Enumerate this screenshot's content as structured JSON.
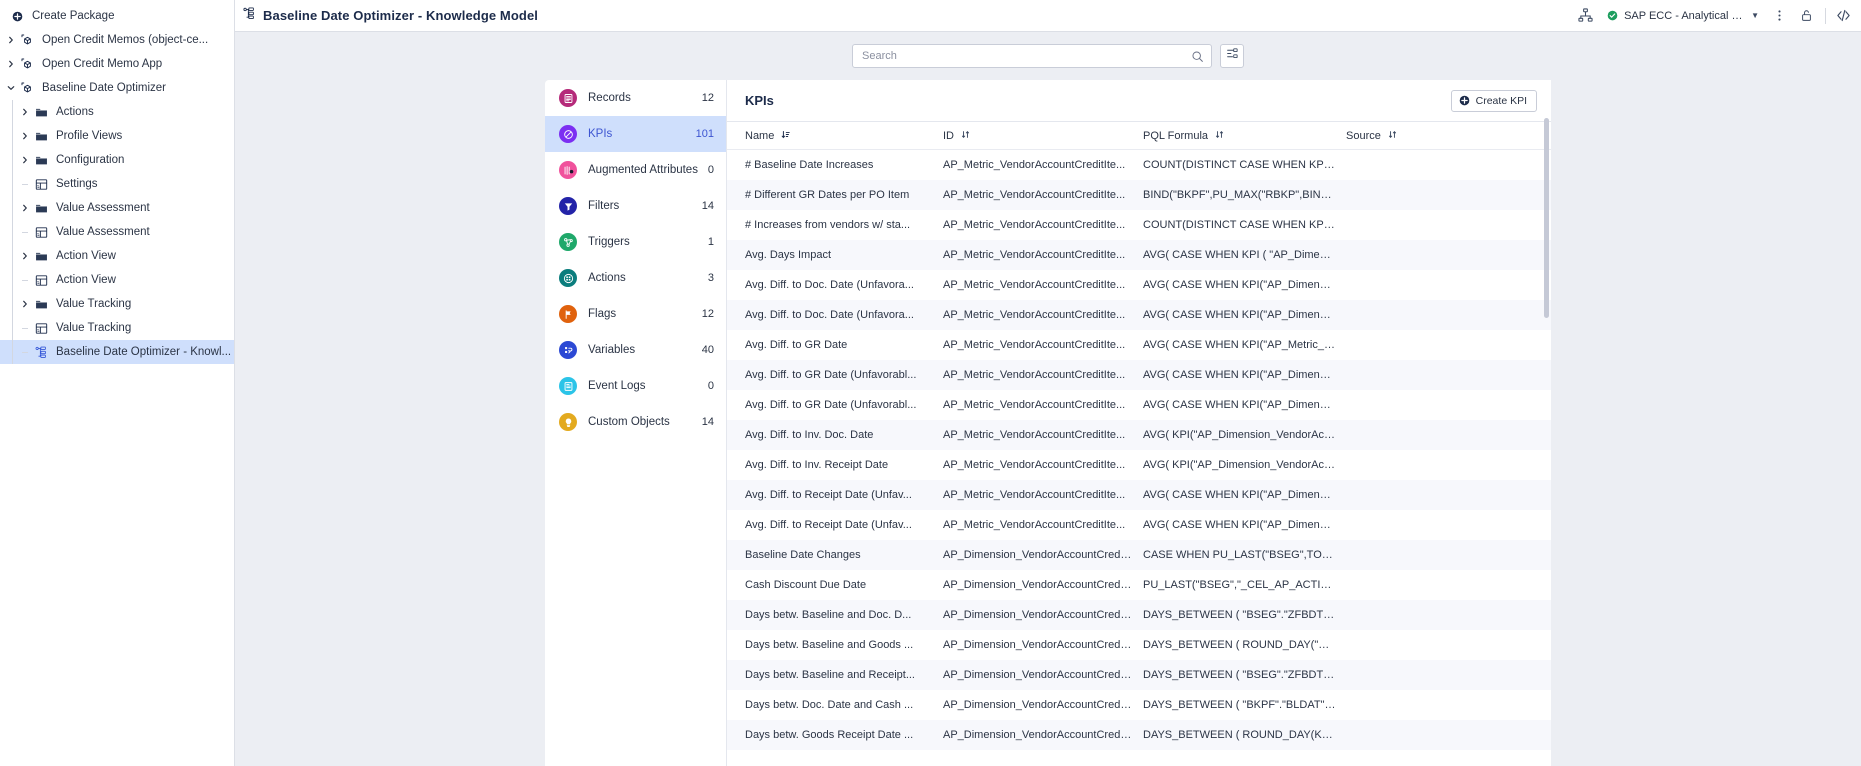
{
  "explorer": {
    "create_label": "Create Package",
    "items": [
      {
        "label": "Open Credit Memos (object-ce...",
        "icon": "package-icon",
        "caret": "right",
        "indent": 0,
        "type": "package"
      },
      {
        "label": "Open Credit Memo App",
        "icon": "package-icon",
        "caret": "right",
        "indent": 0,
        "type": "package"
      },
      {
        "label": "Baseline Date Optimizer",
        "icon": "package-icon",
        "caret": "down",
        "indent": 0,
        "type": "package"
      },
      {
        "label": "Actions",
        "icon": "folder-icon",
        "caret": "right",
        "indent": 1,
        "type": "folder"
      },
      {
        "label": "Profile Views",
        "icon": "folder-icon",
        "caret": "right",
        "indent": 1,
        "type": "folder"
      },
      {
        "label": "Configuration",
        "icon": "folder-icon",
        "caret": "right",
        "indent": 1,
        "type": "folder"
      },
      {
        "label": "Settings",
        "icon": "view-icon",
        "caret": "",
        "indent": 1,
        "type": "view"
      },
      {
        "label": "Value Assessment",
        "icon": "folder-icon",
        "caret": "right",
        "indent": 1,
        "type": "folder"
      },
      {
        "label": "Value Assessment",
        "icon": "view-icon",
        "caret": "",
        "indent": 1,
        "type": "view"
      },
      {
        "label": "Action View",
        "icon": "folder-icon",
        "caret": "right",
        "indent": 1,
        "type": "folder"
      },
      {
        "label": "Action View",
        "icon": "view-icon",
        "caret": "",
        "indent": 1,
        "type": "view"
      },
      {
        "label": "Value Tracking",
        "icon": "folder-icon",
        "caret": "right",
        "indent": 1,
        "type": "folder"
      },
      {
        "label": "Value Tracking",
        "icon": "view-icon",
        "caret": "",
        "indent": 1,
        "type": "view"
      },
      {
        "label": "Baseline Date Optimizer - Knowl...",
        "icon": "knowledge-model-icon",
        "caret": "",
        "indent": 1,
        "type": "knowledge-model",
        "selected": true
      }
    ]
  },
  "topbar": {
    "title": "Baseline Date Optimizer - Knowledge Model",
    "data_model_icon": "data-model-icon",
    "system": "SAP ECC - Analytical (FI O...",
    "status_color": "#1d9e5e",
    "more_icon": "kebab-menu-icon",
    "lock_icon": "unlock-icon",
    "code_icon": "code-brackets-icon"
  },
  "search": {
    "placeholder": "Search",
    "value": "",
    "icon": "search-icon",
    "filter_icon": "filter-settings-icon"
  },
  "categories": [
    {
      "label": "Records",
      "count": "12",
      "color": "#b52a7a",
      "icon": "records-icon"
    },
    {
      "label": "KPIs",
      "count": "101",
      "color": "#7b2ff2",
      "icon": "kpi-icon",
      "active": true
    },
    {
      "label": "Augmented Attributes",
      "count": "0",
      "color": "#f0529c",
      "icon": "augmented-attributes-icon"
    },
    {
      "label": "Filters",
      "count": "14",
      "color": "#2323a8",
      "icon": "filter-icon"
    },
    {
      "label": "Triggers",
      "count": "1",
      "color": "#1fa86a",
      "icon": "trigger-icon"
    },
    {
      "label": "Actions",
      "count": "3",
      "color": "#0b7d7d",
      "icon": "action-icon"
    },
    {
      "label": "Flags",
      "count": "12",
      "color": "#e0620d",
      "icon": "flag-icon"
    },
    {
      "label": "Variables",
      "count": "40",
      "color": "#2c49d4",
      "icon": "variable-icon"
    },
    {
      "label": "Event Logs",
      "count": "0",
      "color": "#2bc4e8",
      "icon": "event-log-icon"
    },
    {
      "label": "Custom Objects",
      "count": "14",
      "color": "#e3aa1f",
      "icon": "custom-object-icon"
    }
  ],
  "table": {
    "title": "KPIs",
    "create_label": "Create KPI",
    "create_icon": "plus-circle-icon",
    "columns": [
      {
        "label": "Name",
        "sort": "desc"
      },
      {
        "label": "ID",
        "sort": "none"
      },
      {
        "label": "PQL Formula",
        "sort": "none"
      },
      {
        "label": "Source",
        "sort": "none"
      }
    ],
    "rows": [
      {
        "name": "# Baseline Date Increases",
        "id": "AP_Metric_VendorAccountCreditIte...",
        "pql": "COUNT(DISTINCT CASE WHEN KPI(...",
        "source": ""
      },
      {
        "name": "# Different GR Dates per PO Item",
        "id": "AP_Metric_VendorAccountCreditIte...",
        "pql": "BIND(\"BKPF\",PU_MAX(\"RBKP\",BIND(...",
        "source": ""
      },
      {
        "name": "# Increases from vendors w/ sta...",
        "id": "AP_Metric_VendorAccountCreditIte...",
        "pql": "COUNT(DISTINCT CASE WHEN KPI(...",
        "source": ""
      },
      {
        "name": "Avg. Days Impact",
        "id": "AP_Metric_VendorAccountCreditIte...",
        "pql": "AVG( CASE WHEN KPI ( \"AP_Dimensi...",
        "source": ""
      },
      {
        "name": "Avg. Diff. to Doc. Date (Unfavora...",
        "id": "AP_Metric_VendorAccountCreditIte...",
        "pql": "AVG( CASE WHEN KPI(\"AP_Dimensio...",
        "source": ""
      },
      {
        "name": "Avg. Diff. to Doc. Date (Unfavora...",
        "id": "AP_Metric_VendorAccountCreditIte...",
        "pql": "AVG( CASE WHEN KPI(\"AP_Dimensio...",
        "source": ""
      },
      {
        "name": "Avg. Diff. to GR Date",
        "id": "AP_Metric_VendorAccountCreditIte...",
        "pql": "AVG( CASE WHEN KPI(\"AP_Metric_V...",
        "source": ""
      },
      {
        "name": "Avg. Diff. to GR Date (Unfavorabl...",
        "id": "AP_Metric_VendorAccountCreditIte...",
        "pql": "AVG( CASE WHEN KPI(\"AP_Dimensio...",
        "source": ""
      },
      {
        "name": "Avg. Diff. to GR Date (Unfavorabl...",
        "id": "AP_Metric_VendorAccountCreditIte...",
        "pql": "AVG( CASE WHEN KPI(\"AP_Dimensio...",
        "source": ""
      },
      {
        "name": "Avg. Diff. to Inv. Doc. Date",
        "id": "AP_Metric_VendorAccountCreditIte...",
        "pql": "AVG( KPI(\"AP_Dimension_VendorAcc...",
        "source": ""
      },
      {
        "name": "Avg. Diff. to Inv. Receipt Date",
        "id": "AP_Metric_VendorAccountCreditIte...",
        "pql": "AVG( KPI(\"AP_Dimension_VendorAcc...",
        "source": ""
      },
      {
        "name": "Avg. Diff. to Receipt Date (Unfav...",
        "id": "AP_Metric_VendorAccountCreditIte...",
        "pql": "AVG( CASE WHEN KPI(\"AP_Dimensio...",
        "source": ""
      },
      {
        "name": "Avg. Diff. to Receipt Date (Unfav...",
        "id": "AP_Metric_VendorAccountCreditIte...",
        "pql": "AVG( CASE WHEN KPI(\"AP_Dimensio...",
        "source": ""
      },
      {
        "name": "Baseline Date Changes",
        "id": "AP_Dimension_VendorAccountCredit...",
        "pql": "CASE WHEN PU_LAST(\"BSEG\",TO_D...",
        "source": ""
      },
      {
        "name": "Cash Discount Due Date",
        "id": "AP_Dimension_VendorAccountCredit...",
        "pql": "PU_LAST(\"BSEG\",\"_CEL_AP_ACTIVITI...",
        "source": ""
      },
      {
        "name": "Days betw. Baseline and Doc. D...",
        "id": "AP_Dimension_VendorAccountCredit...",
        "pql": "DAYS_BETWEEN ( \"BSEG\".\"ZFBDT\" , ...",
        "source": ""
      },
      {
        "name": "Days betw. Baseline and Goods ...",
        "id": "AP_Dimension_VendorAccountCredit...",
        "pql": "DAYS_BETWEEN ( ROUND_DAY(\"BS...",
        "source": ""
      },
      {
        "name": "Days betw. Baseline and Receipt...",
        "id": "AP_Dimension_VendorAccountCredit...",
        "pql": "DAYS_BETWEEN ( \"BSEG\".\"ZFBDT\" , ...",
        "source": ""
      },
      {
        "name": "Days betw. Doc. Date and Cash ...",
        "id": "AP_Dimension_VendorAccountCredit...",
        "pql": "DAYS_BETWEEN ( \"BKPF\".\"BLDAT\" , ...",
        "source": ""
      },
      {
        "name": "Days betw. Goods Receipt Date ...",
        "id": "AP_Dimension_VendorAccountCredit...",
        "pql": "DAYS_BETWEEN ( ROUND_DAY(KPI (...",
        "source": ""
      }
    ]
  }
}
